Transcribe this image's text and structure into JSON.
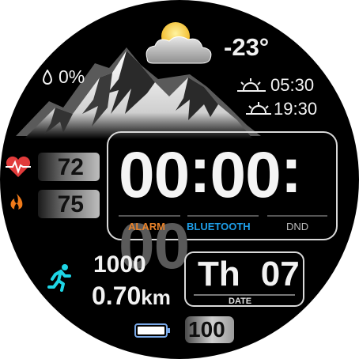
{
  "weather": {
    "icon": "partly-cloudy-icon",
    "temperature": "-23°",
    "humidity": "0%",
    "sunrise": "05:30",
    "sunset": "19:30"
  },
  "metrics": {
    "heart_rate": "72",
    "calories": "75"
  },
  "time": {
    "hours": "00",
    "minutes": "00",
    "seconds": "00",
    "colon": ":"
  },
  "status": {
    "alarm": "ALARM",
    "bluetooth": "BLUETOOTH",
    "dnd": "DND"
  },
  "activity": {
    "steps": "1000",
    "distance_value": "0.70",
    "distance_unit": "km"
  },
  "date": {
    "weekday": "Th",
    "day": "07",
    "label": "DATE"
  },
  "battery": {
    "value": "100"
  },
  "colors": {
    "background": "#000000",
    "alarm": "#e8822a",
    "bluetooth": "#1e9ee8",
    "dnd": "#bdbdbd",
    "heart": "#e23b3b",
    "flame": "#f07a1a",
    "runner": "#1ed6e6",
    "battery_icon": "#7aa9e8"
  }
}
